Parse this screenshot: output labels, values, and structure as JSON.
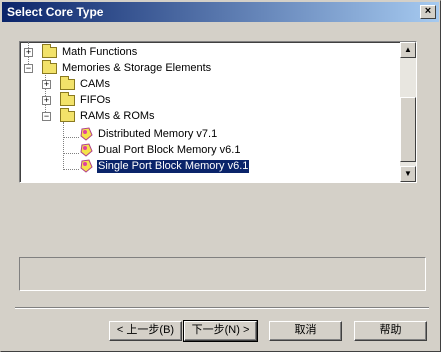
{
  "window": {
    "title": "Select Core Type",
    "close_label": "×"
  },
  "tree": {
    "nodes": [
      {
        "label": "Math Functions",
        "expander": "+"
      },
      {
        "label": "Memories & Storage Elements",
        "expander": "−"
      },
      {
        "label": "CAMs",
        "expander": "+"
      },
      {
        "label": "FIFOs",
        "expander": "+"
      },
      {
        "label": "RAMs & ROMs",
        "expander": "−"
      },
      {
        "label": "Distributed Memory v7.1"
      },
      {
        "label": "Dual Port Block Memory v6.1"
      },
      {
        "label": "Single Port Block Memory v6.1",
        "selected": true
      }
    ],
    "scroll_up": "▲",
    "scroll_down": "▼"
  },
  "buttons": {
    "back": "< 上一步(B)",
    "next": "下一步(N) >",
    "cancel": "取消",
    "help": "帮助"
  },
  "icons": {
    "folder": "folder-icon",
    "memory": "memory-core-icon"
  },
  "colors": {
    "title_start": "#0a246a",
    "title_end": "#a6caf0",
    "selection": "#0a246a",
    "face": "#d4d0c8"
  }
}
